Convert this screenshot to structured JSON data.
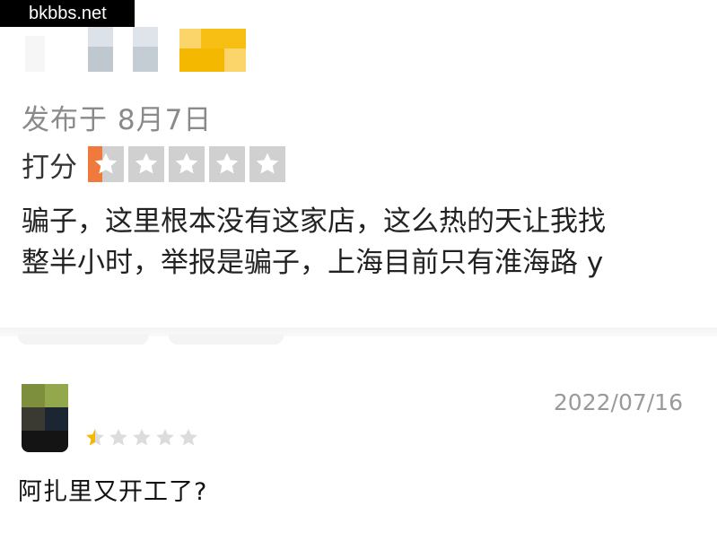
{
  "watermark": {
    "text": "bkbbs.net"
  },
  "review1": {
    "publish_date": "发布于 8月7日",
    "rating_label": "打分",
    "rating": {
      "value": 0.4,
      "max": 5
    },
    "text_lines": [
      "骗子，这里根本没有这家店，这么热的天让我找",
      "整半小时，举报是骗子，上海目前只有淮海路 y"
    ],
    "colors": {
      "star_empty": "#d0d0d0",
      "star_fill": "#f07a3c"
    }
  },
  "review2": {
    "date": "2022/07/16",
    "rating": {
      "value": 0.5,
      "max": 5
    },
    "comment": "阿扎里又开工了?",
    "colors": {
      "star_empty": "#dcdcdc",
      "star_fill": "#f5b800"
    }
  }
}
